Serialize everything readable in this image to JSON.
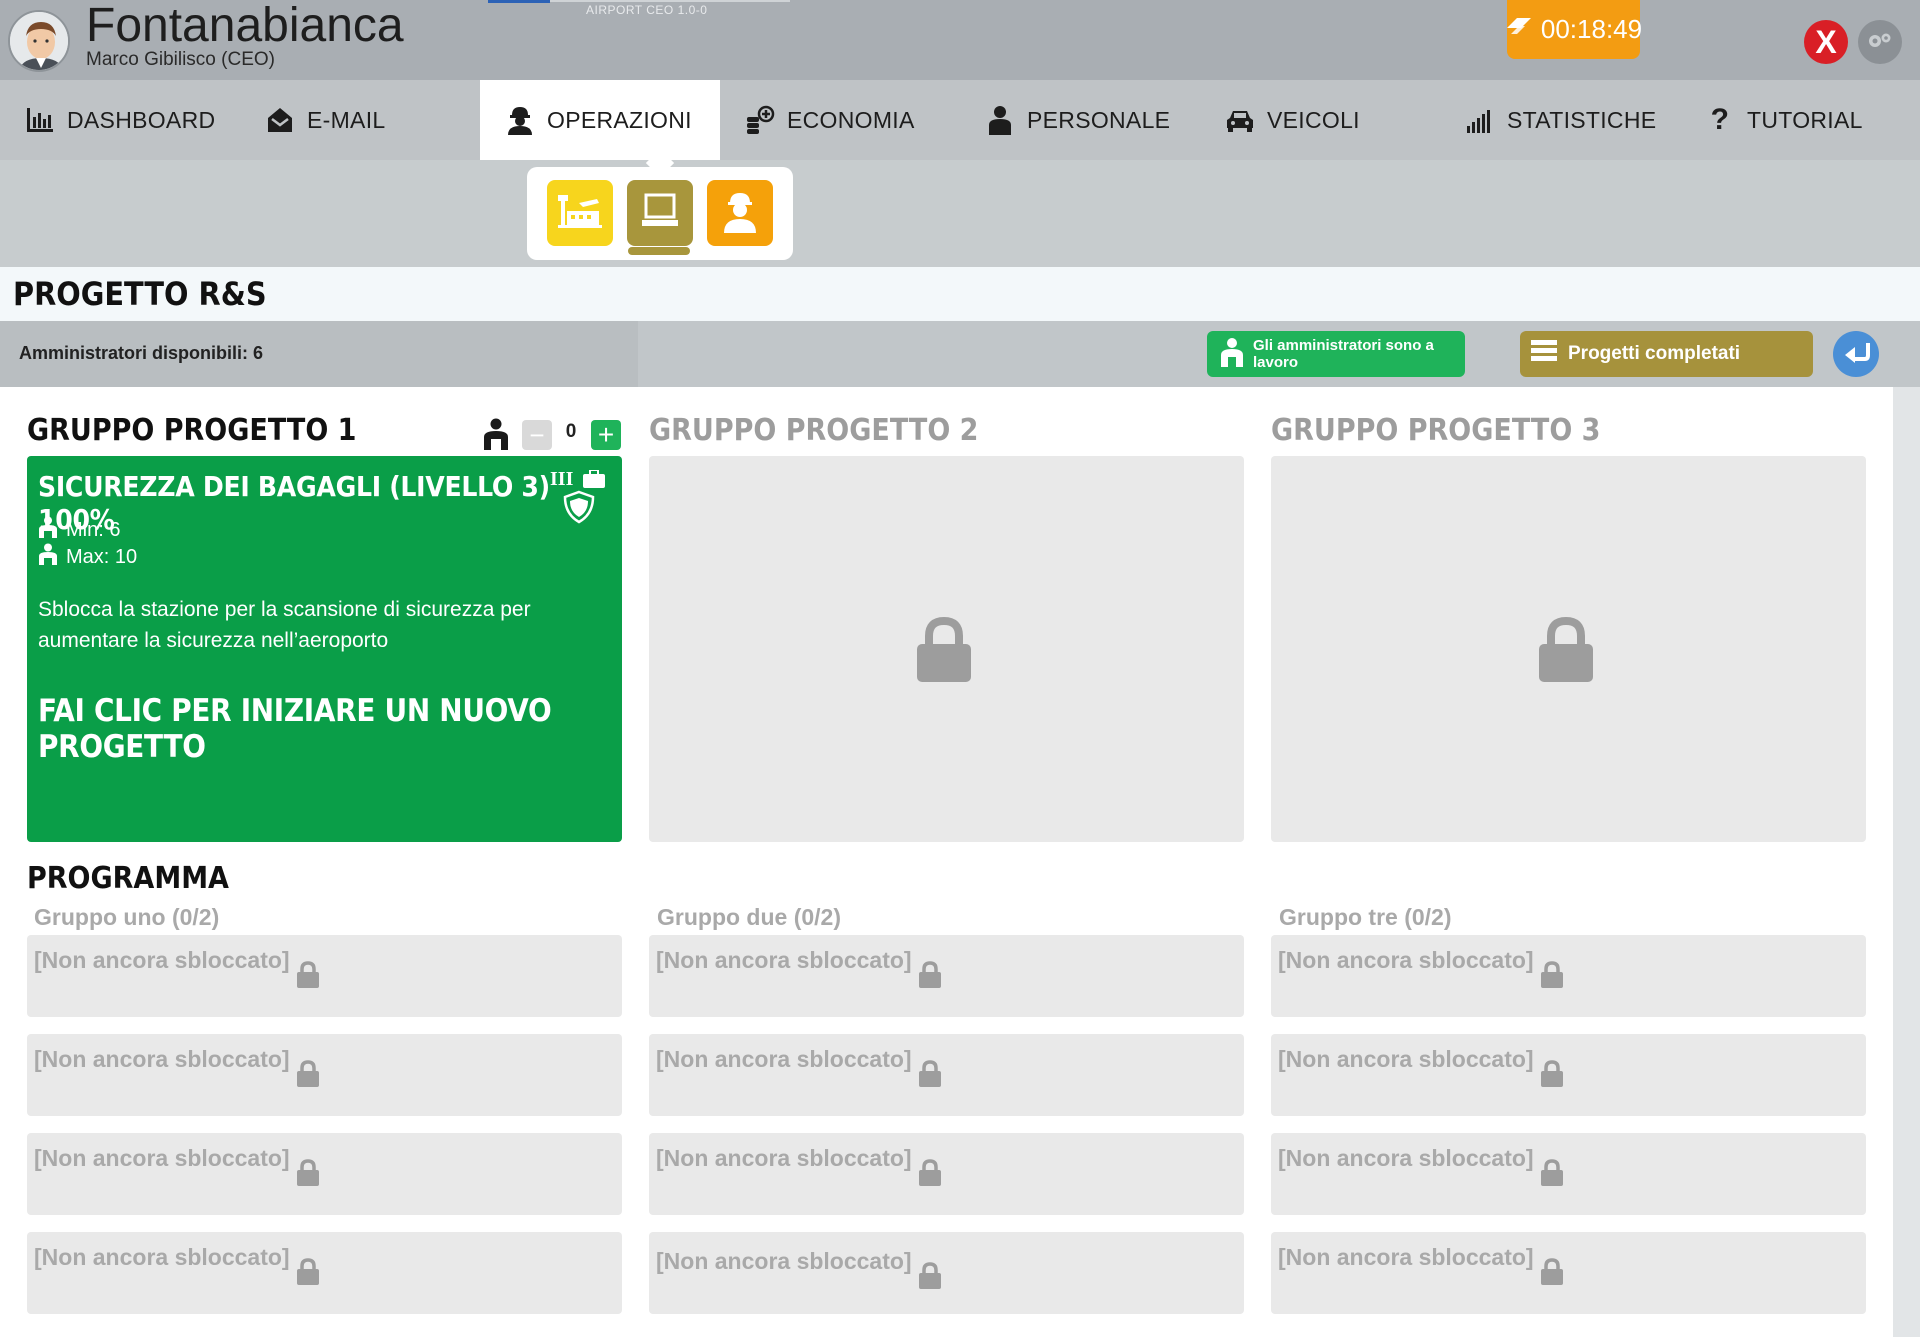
{
  "header": {
    "airport_name": "Fontanabianca",
    "ceo_name": "Marco Gibilisco (CEO)",
    "version": "AIRPORT CEO  1.0-0",
    "timer": "00:18:49",
    "close_label": "X"
  },
  "nav": {
    "items": [
      {
        "label": "DASHBOARD",
        "icon": "bar-chart-icon"
      },
      {
        "label": "E-MAIL",
        "icon": "envelope-icon"
      },
      {
        "label": "OPERAZIONI",
        "icon": "worker-icon"
      },
      {
        "label": "ECONOMIA",
        "icon": "money-icon"
      },
      {
        "label": "PERSONALE",
        "icon": "person-icon"
      },
      {
        "label": "VEICOLI",
        "icon": "car-icon"
      },
      {
        "label": "STATISTICHE",
        "icon": "signal-bars-icon"
      },
      {
        "label": "TUTORIAL",
        "icon": "question-icon"
      }
    ],
    "active": "OPERAZIONI"
  },
  "subnav": {
    "buttons": [
      "airport-icon",
      "computer-icon",
      "worker-icon"
    ],
    "colors": [
      "#f7d51d",
      "#a8963c",
      "#f5a10a"
    ]
  },
  "page": {
    "title": "PROGETTO R&S"
  },
  "info_bar": {
    "admins_available": "Amministratori disponibili: 6",
    "admins_working_label": "Gli amministratori sono a lavoro",
    "completed_projects_label": "Progetti completati"
  },
  "groups": [
    {
      "title": "GRUPPO PROGETTO 1",
      "locked": false
    },
    {
      "title": "GRUPPO PROGETTO 2",
      "locked": true
    },
    {
      "title": "GRUPPO PROGETTO 3",
      "locked": true
    }
  ],
  "group1": {
    "admin_count": "0",
    "minus_label": "−",
    "plus_label": "+",
    "project": {
      "name": "SICUREZZA DEI BAGAGLI (LIVELLO 3) 100%",
      "level_badge": "III",
      "min": "Min: 6",
      "max": "Max: 10",
      "description": "Sblocca la stazione per la scansione di sicurezza per aumentare la sicurezza nell’aeroporto",
      "cta": "FAI CLIC PER INIZIARE UN NUOVO PROGETTO"
    }
  },
  "program": {
    "title": "PROGRAMMA",
    "columns": [
      {
        "label": "Gruppo uno (0/2)",
        "slots": [
          "[Non ancora sbloccato]",
          "[Non ancora sbloccato]",
          "[Non ancora sbloccato]",
          "[Non ancora sbloccato]"
        ]
      },
      {
        "label": "Gruppo due (0/2)",
        "slots": [
          "[Non ancora sbloccato]",
          "[Non ancora sbloccato]",
          "[Non ancora sbloccato]",
          "[Non ancora sbloccato]"
        ]
      },
      {
        "label": "Gruppo tre (0/2)",
        "slots": [
          "[Non ancora sbloccato]",
          "[Non ancora sbloccato]",
          "[Non ancora sbloccato]",
          "[Non ancora sbloccato]"
        ]
      }
    ]
  },
  "colors": {
    "header_bg": "#a9aeb3",
    "nav_bg": "#bfc3c6",
    "active_green": "#0a9e48",
    "button_green": "#1fb35a",
    "gold": "#a6923c",
    "timer_orange": "#f39c12",
    "close_red": "#d91f26",
    "locked_gray": "#e9e9e9"
  }
}
